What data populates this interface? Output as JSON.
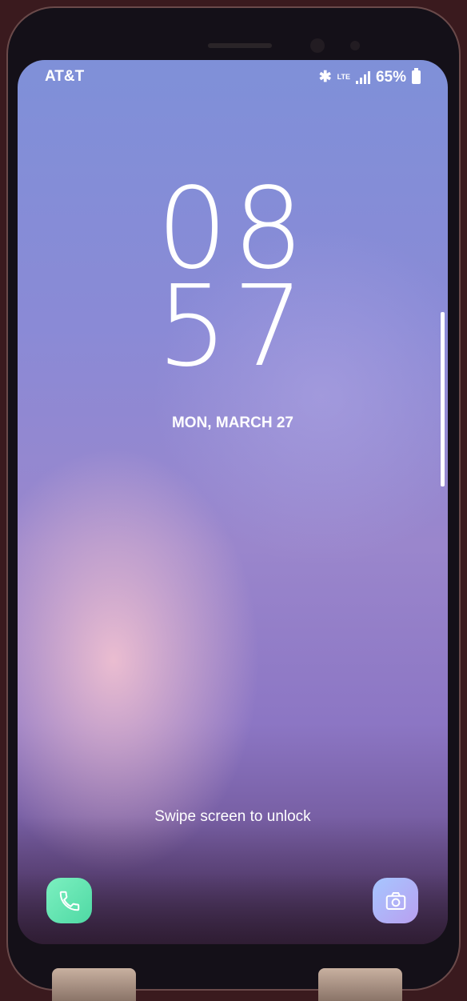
{
  "status_bar": {
    "carrier": "AT&T",
    "network": "LTE",
    "battery": "65%",
    "icons": [
      "bluetooth-icon",
      "lte-icon",
      "signal-icon",
      "battery-icon"
    ]
  },
  "clock": {
    "hours": "08",
    "minutes": "57"
  },
  "date": "MON, MARCH 27",
  "hint": "Swipe screen to unlock",
  "shortcuts": {
    "left": "phone-icon",
    "right": "camera-icon"
  },
  "colors": {
    "phone_button": "#5fe3b0",
    "camera_button": "#b0b4f4"
  }
}
